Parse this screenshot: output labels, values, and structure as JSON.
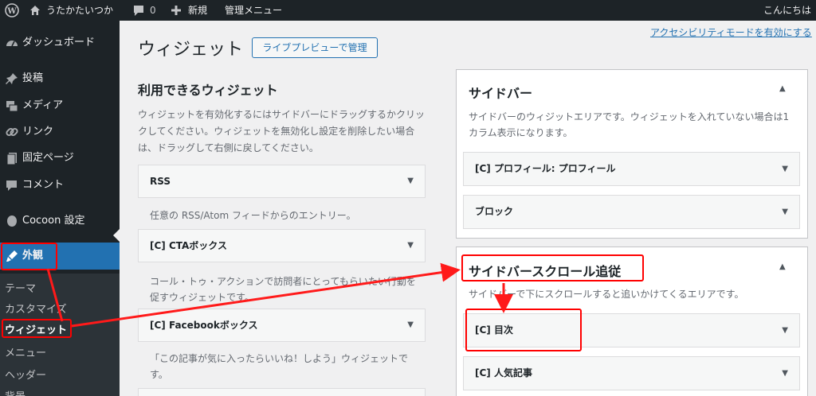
{
  "adminbar": {
    "site_name": "うたかたいつか",
    "comment_count": "0",
    "new_label": "新規",
    "admin_menu_label": "管理メニュー",
    "greeting": "こんにちは"
  },
  "sidebar": {
    "items": [
      {
        "label": "ダッシュボード",
        "icon": "dashboard-icon"
      },
      {
        "label": "投稿",
        "icon": "pin-icon"
      },
      {
        "label": "メディア",
        "icon": "media-icon"
      },
      {
        "label": "リンク",
        "icon": "link-icon"
      },
      {
        "label": "固定ページ",
        "icon": "page-icon"
      },
      {
        "label": "コメント",
        "icon": "comment-icon"
      },
      {
        "label": "Cocoon 設定",
        "icon": "cocoon-icon"
      },
      {
        "label": "外観",
        "icon": "appearance-icon"
      }
    ],
    "submenu": [
      "テーマ",
      "カスタマイズ",
      "ウィジェット",
      "メニュー",
      "ヘッダー",
      "背景"
    ]
  },
  "main": {
    "title": "ウィジェット",
    "live_preview_button": "ライブプレビューで管理",
    "accessibility_link": "アクセシビリティモードを有効にする"
  },
  "available": {
    "title": "利用できるウィジェット",
    "description": "ウィジェットを有効化するにはサイドバーにドラッグするかクリックしてください。ウィジェットを無効化し設定を削除したい場合は、ドラッグして右側に戻してください。",
    "widgets": [
      {
        "name": "RSS",
        "description": "任意の RSS/Atom フィードからのエントリー。"
      },
      {
        "name": "[C] CTAボックス",
        "description": "コール・トゥ・アクションで訪問者にとってもらいたい行動を促すウィジェットです。"
      },
      {
        "name": "[C] Facebookボックス",
        "description": "「この記事が気に入ったらいいね！しよう」ウィジェットです。"
      }
    ]
  },
  "areas": [
    {
      "title": "サイドバー",
      "description": "サイドバーのウィジットエリアです。ウィジェットを入れていない場合は1カラム表示になります。",
      "widgets": [
        "[C] プロフィール: プロフィール",
        "ブロック"
      ]
    },
    {
      "title": "サイドバースクロール追従",
      "description": "サイドバーで下にスクロールすると追いかけてくるエリアです。",
      "widgets": [
        "[C] 目次",
        "[C] 人気記事"
      ]
    }
  ],
  "colors": {
    "admin_dark": "#1d2327",
    "accent": "#2271b1",
    "annotation": "#ff0000"
  }
}
